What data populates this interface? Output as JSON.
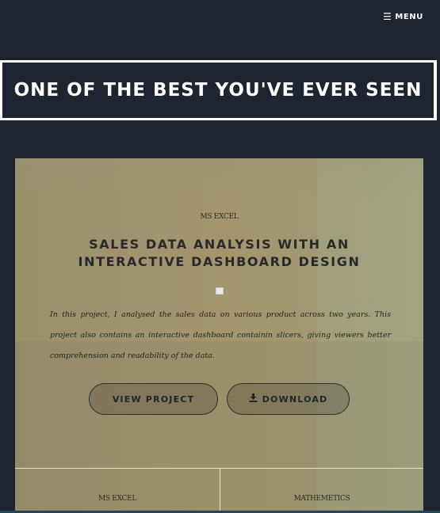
{
  "nav": {
    "menu_label": "MENU",
    "menu_icon": "hamburger-icon"
  },
  "hero": {
    "title": "ONE OF THE BEST YOU'VE EVER SEEN"
  },
  "project": {
    "category": "MS EXCEL",
    "title": "SALES DATA ANALYSIS WITH AN INTERACTIVE DASHBOARD DESIGN",
    "description": "In this project, I analysed the sales data on various product across two years. This project also contains an interactive dashboard containin slicers, giving viewers better comprehension and readability of the data.",
    "view_button": "VIEW PROJECT",
    "download_button": "DOWNLOAD",
    "download_icon": "download-icon"
  },
  "next_cards": [
    {
      "category": "MS EXCEL"
    },
    {
      "category": "MATHEMETICS"
    }
  ],
  "colors": {
    "page_bg": "#1f2530",
    "card_bg": "#a2936f",
    "text_dark": "#262a2a",
    "white": "#ffffff"
  }
}
